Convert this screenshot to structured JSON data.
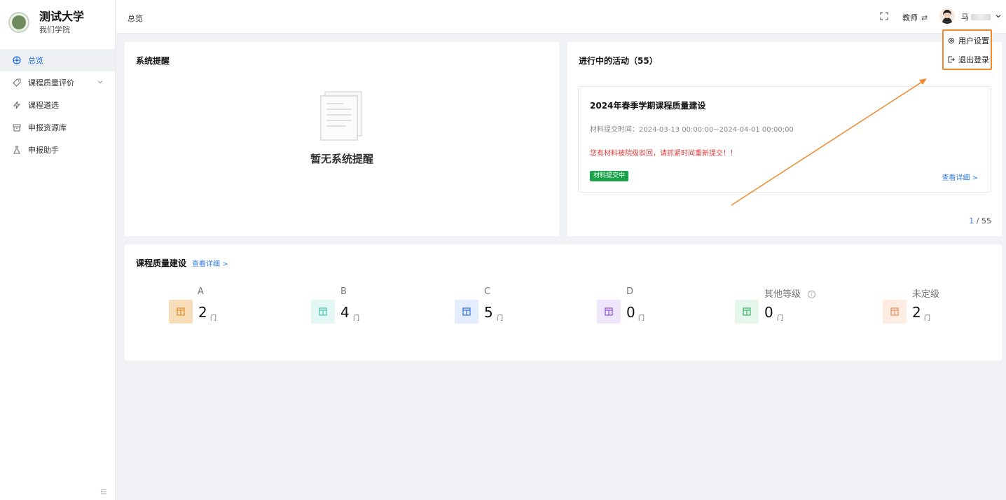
{
  "sidebar": {
    "brand_title": "测试大学",
    "brand_subtitle": "我们学院",
    "logo_text": "测试大学",
    "items": [
      {
        "label": "总览"
      },
      {
        "label": "课程质量评价"
      },
      {
        "label": "课程遴选"
      },
      {
        "label": "申报资源库"
      },
      {
        "label": "申报助手"
      }
    ]
  },
  "header": {
    "title": "总览",
    "role": "教师",
    "role_switch": "⇄",
    "user": "马"
  },
  "dropdown": {
    "items": [
      {
        "label": "用户设置"
      },
      {
        "label": "退出登录"
      }
    ]
  },
  "reminder": {
    "title": "系统提醒",
    "empty": "暂无系统提醒"
  },
  "activity": {
    "title": "进行中的活动（55）",
    "name": "2024年春季学期课程质量建设",
    "time": "材料提交时间：2024-03-13 00:00:00~2024-04-01 00:00:00",
    "warning": "您有材料被院级驳回，请抓紧时间重新提交！！",
    "tag": "材料提交中",
    "detail": "查看详细 >",
    "page_current": "1",
    "page_sep": " / ",
    "page_total": "55"
  },
  "quality": {
    "title": "课程质量建设",
    "link": "查看详细 >",
    "unit": "门",
    "grades": [
      {
        "label": "A",
        "count": "2",
        "color": "#f7ddb8",
        "icon_color": "#e88a2a"
      },
      {
        "label": "B",
        "count": "4",
        "color": "#e3f7f4",
        "icon_color": "#49c3b0"
      },
      {
        "label": "C",
        "count": "5",
        "color": "#e4edfd",
        "icon_color": "#3572e0"
      },
      {
        "label": "D",
        "count": "0",
        "color": "#f0e6fb",
        "icon_color": "#8a4fd8"
      },
      {
        "label": "其他等级",
        "count": "0",
        "color": "#e5f7ea",
        "icon_color": "#3fb26b"
      },
      {
        "label": "未定级",
        "count": "2",
        "color": "#fdece2",
        "icon_color": "#ef8b57"
      }
    ]
  },
  "colors": {
    "primary": "#1c6fe8",
    "warning_text": "#e23a3a",
    "tag_green": "#1aa34a",
    "highlight_orange": "#f08a2c"
  }
}
